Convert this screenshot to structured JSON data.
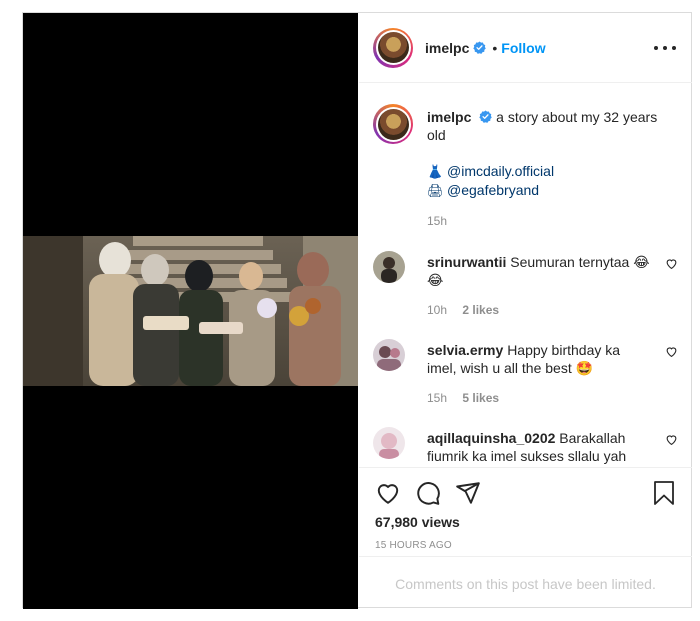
{
  "post": {
    "author": {
      "username": "imelpc",
      "verified": true,
      "follow_label": "Follow",
      "dot": "•"
    },
    "caption": {
      "username": "imelpc",
      "text": "a story about my 32 years old",
      "mentions": [
        {
          "emoji": "👗",
          "handle": "@imcdaily.official"
        },
        {
          "emoji": "🖨",
          "handle": "@egafebryand"
        }
      ],
      "time": "15h"
    },
    "comments": [
      {
        "username": "srinurwantii",
        "text": "Seumuran ternytaa 😂😂",
        "time": "10h",
        "likes": "2 likes"
      },
      {
        "username": "selvia.ermy",
        "text": "Happy birthday ka imel, wish u all the best 🤩",
        "time": "15h",
        "likes": "5 likes"
      },
      {
        "username": "aqillaquinsha_0202",
        "text": "Barakallah fiumrik ka imel sukses sllalu yah",
        "time": "",
        "likes": ""
      }
    ],
    "views": "67,980 views",
    "posted_ago": "15 HOURS AGO",
    "comments_limited": "Comments on this post have been limited."
  },
  "colors": {
    "accent": "#0095f6",
    "text": "#262626",
    "muted": "#8e8e8e",
    "mention": "#00376b"
  },
  "icons": [
    "verified-badge-icon",
    "more-options-icon",
    "heart-icon",
    "comment-icon",
    "share-icon",
    "bookmark-icon",
    "like-comment-icon"
  ]
}
